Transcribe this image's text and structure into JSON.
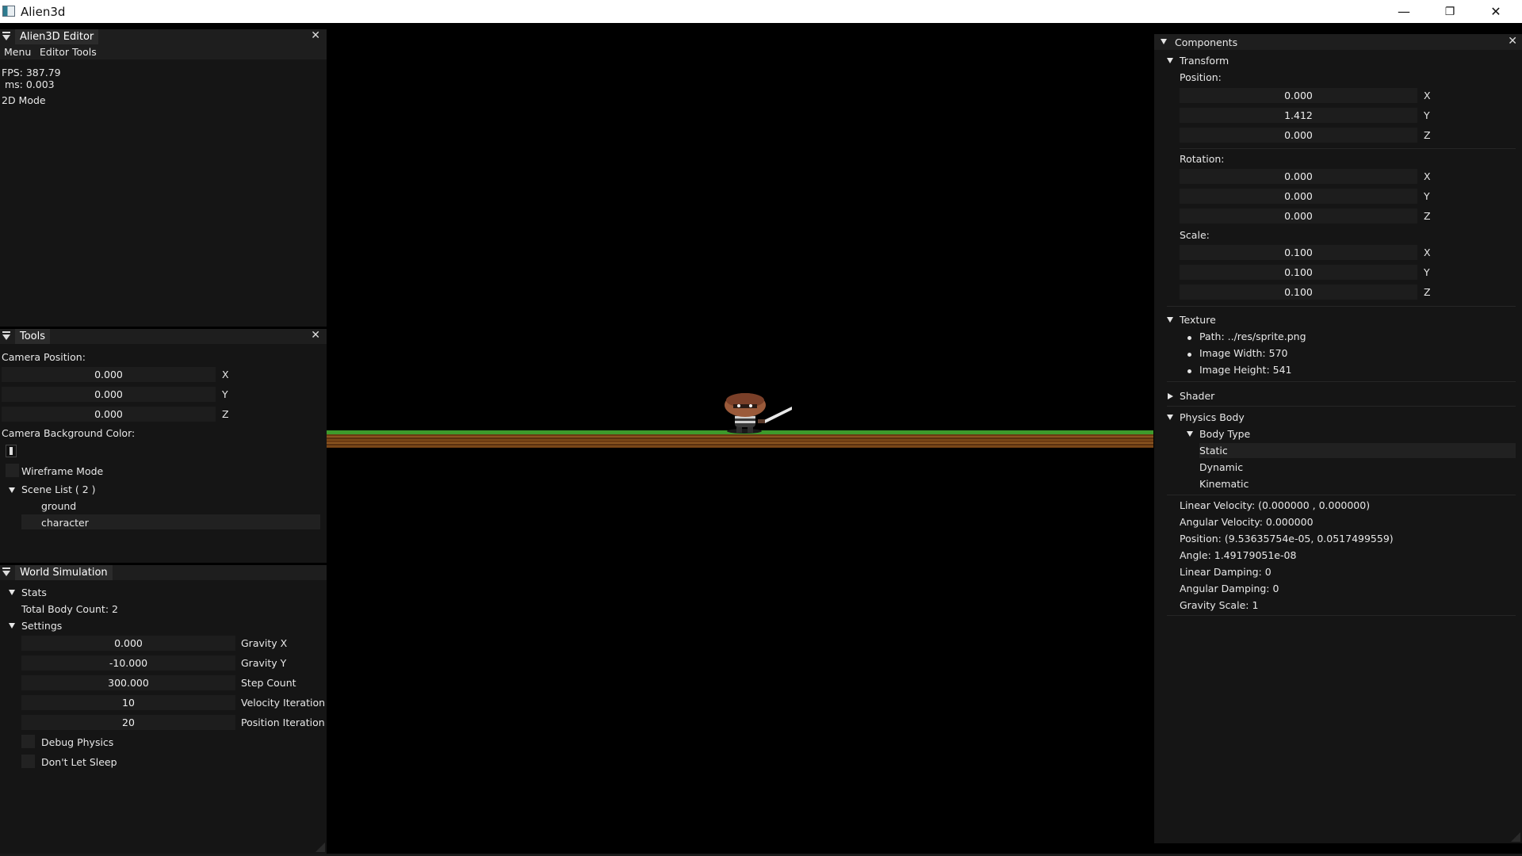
{
  "window": {
    "title": "Alien3d",
    "minimize": "—",
    "restore": "❐",
    "close": "✕"
  },
  "editor_panel": {
    "title": "Alien3D Editor",
    "menu": [
      "Menu",
      "Editor Tools"
    ],
    "fps": "FPS: 387.79",
    "ms": " ms: 0.003",
    "mode": "2D Mode"
  },
  "tools_panel": {
    "title": "Tools",
    "camera_position_label": "Camera Position:",
    "camera": [
      {
        "value": "0.000",
        "axis": "X"
      },
      {
        "value": "0.000",
        "axis": "Y"
      },
      {
        "value": "0.000",
        "axis": "Z"
      }
    ],
    "bg_color_label": "Camera Background Color:",
    "wireframe_label": "Wireframe Mode",
    "scene_list_label": "Scene List ( 2 )",
    "scene_items": [
      "ground",
      "character"
    ]
  },
  "world_panel": {
    "title": "World Simulation",
    "stats_label": "Stats",
    "total_body_count": "Total Body Count: 2",
    "settings_label": "Settings",
    "settings": [
      {
        "value": "0.000",
        "label": "Gravity X"
      },
      {
        "value": "-10.000",
        "label": "Gravity Y"
      },
      {
        "value": "300.000",
        "label": "Step Count"
      },
      {
        "value": "10",
        "label": "Velocity Iteration"
      },
      {
        "value": "20",
        "label": "Position Iteration"
      }
    ],
    "debug_physics": "Debug Physics",
    "dont_let_sleep": "Don't Let Sleep"
  },
  "components_panel": {
    "title": "Components",
    "transform_label": "Transform",
    "position_label": "Position:",
    "position": [
      {
        "value": "0.000",
        "axis": "X"
      },
      {
        "value": "1.412",
        "axis": "Y"
      },
      {
        "value": "0.000",
        "axis": "Z"
      }
    ],
    "rotation_label": "Rotation:",
    "rotation": [
      {
        "value": "0.000",
        "axis": "X"
      },
      {
        "value": "0.000",
        "axis": "Y"
      },
      {
        "value": "0.000",
        "axis": "Z"
      }
    ],
    "scale_label": "Scale:",
    "scale": [
      {
        "value": "0.100",
        "axis": "X"
      },
      {
        "value": "0.100",
        "axis": "Y"
      },
      {
        "value": "0.100",
        "axis": "Z"
      }
    ],
    "texture_label": "Texture",
    "texture_path": "Path: ../res/sprite.png",
    "texture_width": "Image Width: 570",
    "texture_height": "Image Height: 541",
    "shader_label": "Shader",
    "physics_label": "Physics Body",
    "body_type_label": "Body Type",
    "body_types": [
      "Static",
      "Dynamic",
      "Kinematic"
    ],
    "linear_velocity": "Linear Velocity: (0.000000 , 0.000000)",
    "angular_velocity": "Angular Velocity: 0.000000",
    "phys_position": "Position: (9.53635754e-05, 0.0517499559)",
    "angle": "Angle: 1.49179051e-08",
    "linear_damping": "Linear Damping: 0",
    "angular_damping": "Angular Damping: 0",
    "gravity_scale": "Gravity Scale: 1"
  }
}
